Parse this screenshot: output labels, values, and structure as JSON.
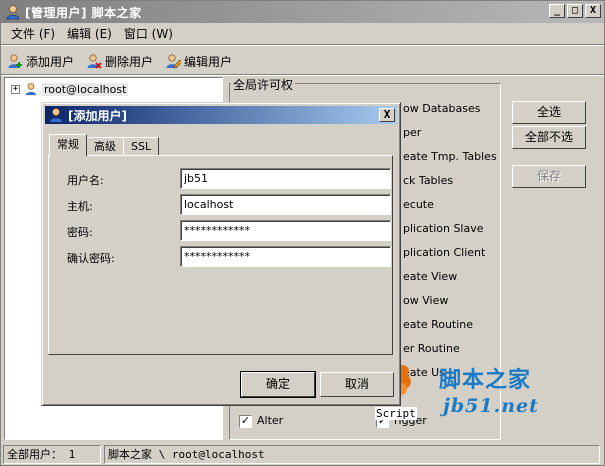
{
  "window": {
    "title": "[管理用户] 脚本之家",
    "min_label": "_",
    "max_label": "□",
    "close_label": "X"
  },
  "menu": [
    {
      "label": "文件 (F)"
    },
    {
      "label": "编辑 (E)"
    },
    {
      "label": "窗口 (W)"
    }
  ],
  "toolbar": {
    "add_user": "添加用户",
    "delete_user": "删除用户",
    "edit_user": "编辑用户"
  },
  "tree": {
    "expander": "+",
    "root_label": "root@localhost"
  },
  "privileges": {
    "legend": "全局许可权",
    "items": [
      {
        "label": "ow Databases"
      },
      {
        "label": "per"
      },
      {
        "label": "eate Tmp. Tables"
      },
      {
        "label": "ck Tables"
      },
      {
        "label": "ecute"
      },
      {
        "label": "plication Slave"
      },
      {
        "label": "plication Client"
      },
      {
        "label": "eate View"
      },
      {
        "label": "ow View"
      },
      {
        "label": "eate Routine"
      },
      {
        "label": "er Routine"
      },
      {
        "label": "eate Us"
      }
    ],
    "bottom_left": {
      "label": "Alter",
      "checked": true
    },
    "bottom_right": {
      "label": "rigger",
      "checked": true
    },
    "check_mark": "✓"
  },
  "right_buttons": {
    "select_all": "全选",
    "select_none": "全部不选",
    "save": "保存"
  },
  "statusbar": {
    "total_users": "全部用户： 1",
    "path": "脚本之家 \\ root@localhost"
  },
  "watermark": {
    "cn": "脚本之家",
    "en": "jb51.net",
    "script": "Script"
  },
  "dialog": {
    "title": "[添加用户]",
    "close_label": "X",
    "tabs": [
      {
        "label": "常规",
        "active": true
      },
      {
        "label": "高级",
        "active": false
      },
      {
        "label": "SSL",
        "active": false
      }
    ],
    "fields": {
      "username_label": "用户名:",
      "username_value": "jb51",
      "host_label": "主机:",
      "host_value": "localhost",
      "password_label": "密码:",
      "password_value": "************",
      "confirm_label": "确认密码:",
      "confirm_value": "************"
    },
    "ok_label": "确定",
    "cancel_label": "取消"
  }
}
